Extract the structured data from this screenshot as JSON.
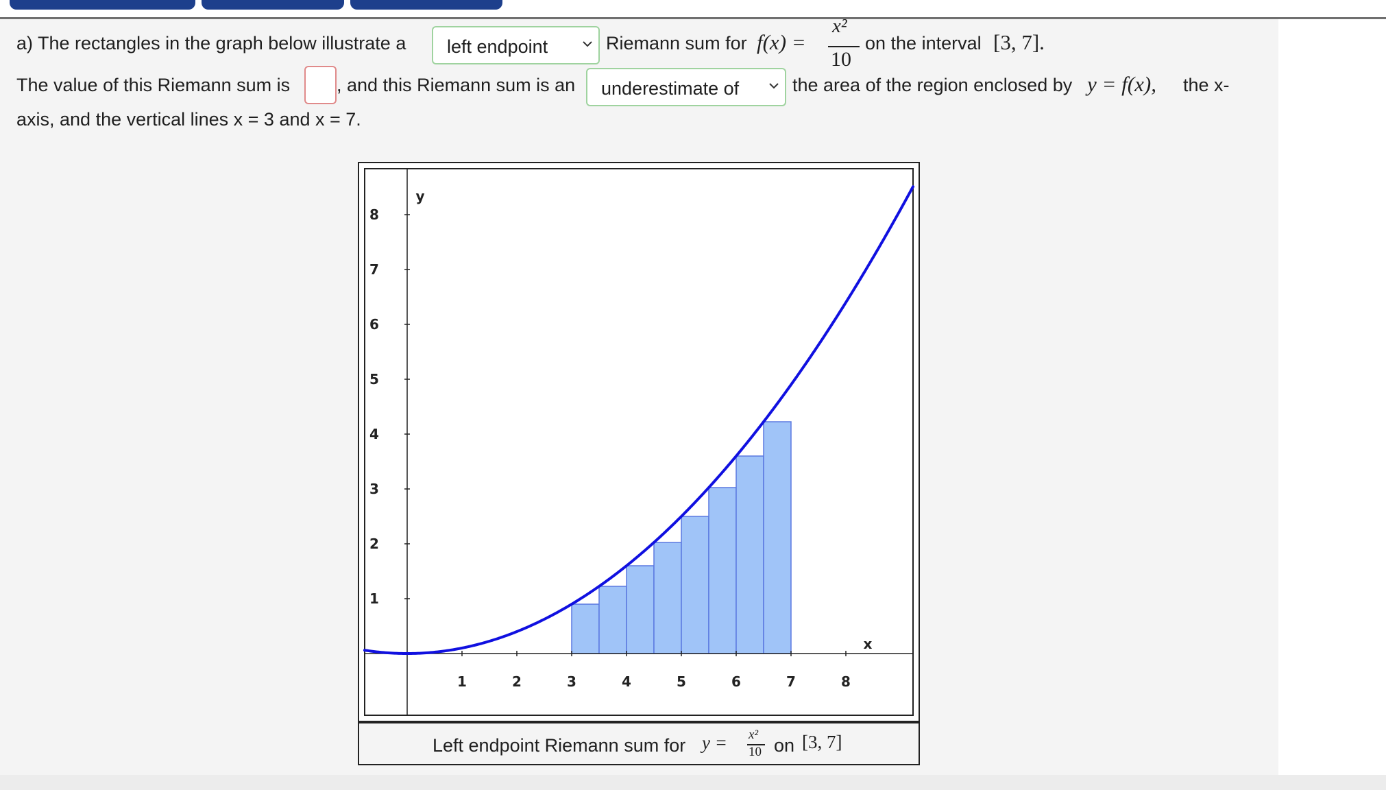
{
  "toolbar": {
    "button_color": "#1d3f8c"
  },
  "question": {
    "prefix": "a) The rectangles in the graph below illustrate a",
    "method_select": {
      "selected": "left endpoint"
    },
    "riemann_for": "Riemann sum for",
    "f_of_x": "f(x) =",
    "numerator": "x²",
    "denominator": "10",
    "on_interval": "on the interval",
    "interval": "[3, 7].",
    "value_prefix": "The value of this Riemann sum is",
    "value_suffix": ", and this Riemann sum is an",
    "estimate_select": {
      "selected": "underestimate of"
    },
    "area_text": "the area of the region enclosed by",
    "y_eq_fx": "y = f(x),",
    "the_x": "the x-",
    "line3": "axis, and the vertical lines x = 3 and x = 7."
  },
  "chart_data": {
    "type": "area",
    "function": "x^2/10",
    "xlabel": "x",
    "ylabel": "y",
    "xlim": [
      -1,
      9
    ],
    "ylim": [
      -1,
      9
    ],
    "x_ticks": [
      "1",
      "2",
      "3",
      "4",
      "5",
      "6",
      "7",
      "8"
    ],
    "y_ticks": [
      "1",
      "2",
      "3",
      "4",
      "5",
      "6",
      "7",
      "8"
    ],
    "interval": [
      3,
      7
    ],
    "rectangles": [
      {
        "x0": 3.0,
        "x1": 3.5,
        "height": 0.9
      },
      {
        "x0": 3.5,
        "x1": 4.0,
        "height": 1.225
      },
      {
        "x0": 4.0,
        "x1": 4.5,
        "height": 1.6
      },
      {
        "x0": 4.5,
        "x1": 5.0,
        "height": 2.025
      },
      {
        "x0": 5.0,
        "x1": 5.5,
        "height": 2.5
      },
      {
        "x0": 5.5,
        "x1": 6.0,
        "height": 3.025
      },
      {
        "x0": 6.0,
        "x1": 6.5,
        "height": 3.6
      },
      {
        "x0": 6.5,
        "x1": 7.0,
        "height": 4.225
      }
    ],
    "curve_color": "#1010e0",
    "rect_fill": "#a0c4f8",
    "rect_stroke": "#5a78e0"
  },
  "caption": {
    "text": "Left endpoint Riemann sum for",
    "y_eq": "y =",
    "numerator": "x²",
    "denominator": "10",
    "on": "on",
    "interval": "[3, 7]"
  }
}
